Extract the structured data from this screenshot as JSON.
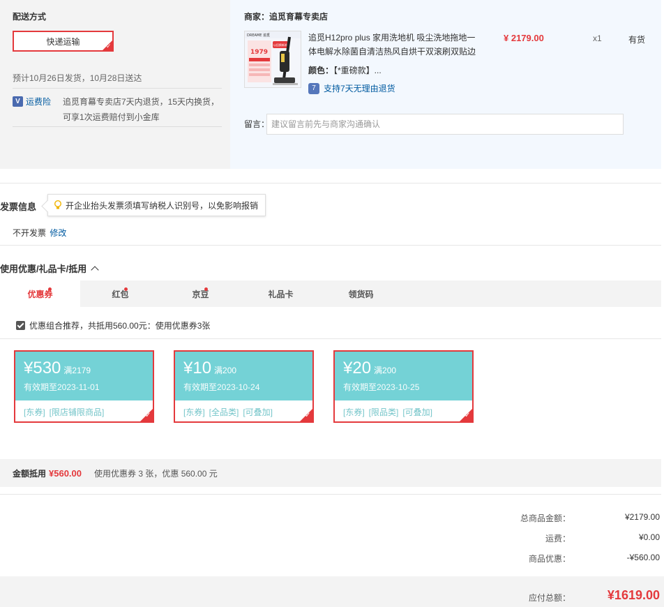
{
  "shipping": {
    "title": "配送方式",
    "method": "快递运输",
    "estimate": "预计10月26日发货，10月28日送达",
    "insurance_icon": "V",
    "insurance_label": "运费险",
    "insurance_text": "追觅育幕专卖店7天内退货，15天内换货，可享1次运费赔付到小金库"
  },
  "order": {
    "merchant": "商家：追觅育幕专卖店",
    "product_name": "追觅H12pro plus 家用洗地机 吸尘洗地拖地一体电解水除菌自清洁热风自烘干双滚刷双贴边",
    "price": "¥ 2179.00",
    "quantity": "x1",
    "stock": "有货",
    "color_label": "颜色：",
    "color_value": "【*重磅款】...",
    "return_icon": "7",
    "return_text": "支持7天无理由退货",
    "remark_label": "留言：",
    "remark_placeholder": "建议留言前先与商家沟通确认",
    "image_text": {
      "brand": "DREAME 追觅",
      "big_price": "1979",
      "banner": "以旧换新补贴"
    }
  },
  "invoice": {
    "title": "发票信息",
    "tip": "开企业抬头发票须填写纳税人识别号，以免影响报销",
    "status": "不开发票",
    "edit": "修改"
  },
  "coupon_section": {
    "title": "使用优惠/礼品卡/抵用",
    "tabs": [
      {
        "label": "优惠券",
        "dot": true
      },
      {
        "label": "红包",
        "dot": true
      },
      {
        "label": "京豆",
        "dot": true
      },
      {
        "label": "礼品卡",
        "dot": false
      },
      {
        "label": "领货码",
        "dot": false
      }
    ],
    "combo_text": "优惠组合推荐，共抵用560.00元：使用优惠券3张",
    "coupons": [
      {
        "amount": "¥530",
        "threshold": "满2179",
        "expiry": "有效期至2023-11-01",
        "tags": [
          "[东券]",
          "[限店铺限商品]"
        ]
      },
      {
        "amount": "¥10",
        "threshold": "满200",
        "expiry": "有效期至2023-10-24",
        "tags": [
          "[东券]",
          "[全品类]",
          "[可叠加]"
        ]
      },
      {
        "amount": "¥20",
        "threshold": "满200",
        "expiry": "有效期至2023-10-25",
        "tags": [
          "[东券]",
          "[限品类]",
          "[可叠加]"
        ]
      }
    ],
    "summary_label": "金额抵用",
    "summary_value": "¥560.00",
    "summary_desc": "使用优惠券 3 张，优惠 560.00 元"
  },
  "totals": {
    "goods_label": "总商品金额：",
    "goods_value": "¥2179.00",
    "freight_label": "运费：",
    "freight_value": "¥0.00",
    "discount_label": "商品优惠：",
    "discount_value": "-¥560.00",
    "pay_label": "应付总额：",
    "pay_value": "¥1619.00"
  },
  "colors": {
    "accent": "#e4393c",
    "coupon_teal": "#74d2d6",
    "link_blue": "#005aa0"
  }
}
